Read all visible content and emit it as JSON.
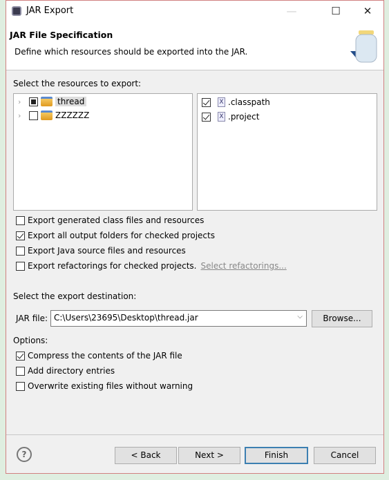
{
  "window": {
    "title": "JAR Export",
    "minimize": "—",
    "maximize": "☐",
    "close": "✕"
  },
  "header": {
    "title": "JAR File Specification",
    "description": "Define which resources should be exported into the JAR."
  },
  "resources": {
    "label": "Select the resources to export:",
    "tree": [
      {
        "label": "thread",
        "state": "partial"
      },
      {
        "label": "ZZZZZZ",
        "state": "unchecked"
      }
    ],
    "files": [
      {
        "label": ".classpath",
        "checked": true
      },
      {
        "label": ".project",
        "checked": true
      }
    ]
  },
  "options1": [
    {
      "label": "Export generated class files and resources",
      "checked": false
    },
    {
      "label": "Export all output folders for checked projects",
      "checked": true
    },
    {
      "label": "Export Java source files and resources",
      "checked": false
    },
    {
      "label": "Export refactorings for checked projects.",
      "checked": false,
      "link": "Select refactorings..."
    }
  ],
  "destination": {
    "label": "Select the export destination:",
    "jar_label": "JAR file:",
    "jar_value": "C:\\Users\\23695\\Desktop\\thread.jar",
    "browse": "Browse..."
  },
  "options": {
    "label": "Options:",
    "items": [
      {
        "label": "Compress the contents of the JAR file",
        "checked": true
      },
      {
        "label": "Add directory entries",
        "checked": false
      },
      {
        "label": "Overwrite existing files without warning",
        "checked": false
      }
    ]
  },
  "footer": {
    "help": "?",
    "back": "< Back",
    "next": "Next >",
    "finish": "Finish",
    "cancel": "Cancel"
  }
}
